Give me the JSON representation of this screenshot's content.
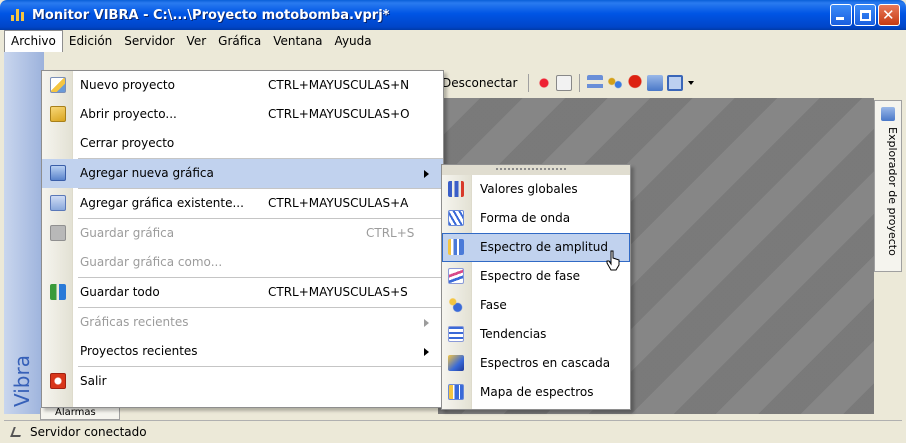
{
  "window": {
    "title": "Monitor VIBRA - C:\\...\\Proyecto motobomba.vprj*"
  },
  "menubar": {
    "items": [
      "Archivo",
      "Edición",
      "Servidor",
      "Ver",
      "Gráfica",
      "Ventana",
      "Ayuda"
    ]
  },
  "toolbar": {
    "disconnect_label": "Desconectar"
  },
  "explorer_tab": {
    "label": "Explorador de proyecto"
  },
  "sidebar": {
    "brand": "Vibra"
  },
  "alarm_tab": {
    "label": "Alarmas"
  },
  "statusbar": {
    "text": "Servidor conectado"
  },
  "file_menu": {
    "items": [
      {
        "label": "Nuevo proyecto",
        "shortcut": "CTRL+MAYUSCULAS+N",
        "icon": "new-project-icon",
        "enabled": true
      },
      {
        "label": "Abrir proyecto...",
        "shortcut": "CTRL+MAYUSCULAS+O",
        "icon": "open-folder-icon",
        "enabled": true
      },
      {
        "label": "Cerrar proyecto",
        "shortcut": "",
        "icon": "",
        "enabled": true
      },
      {
        "label": "Agregar nueva gráfica",
        "shortcut": "",
        "icon": "add-chart-icon",
        "enabled": true,
        "submenu": true,
        "highlighted": true
      },
      {
        "label": "Agregar gráfica existente...",
        "shortcut": "CTRL+MAYUSCULAS+A",
        "icon": "existing-chart-icon",
        "enabled": true
      },
      {
        "label": "Guardar gráfica",
        "shortcut": "CTRL+S",
        "icon": "save-icon",
        "enabled": false
      },
      {
        "label": "Guardar gráfica como...",
        "shortcut": "",
        "icon": "",
        "enabled": false
      },
      {
        "label": "Guardar todo",
        "shortcut": "CTRL+MAYUSCULAS+S",
        "icon": "save-all-icon",
        "enabled": true
      },
      {
        "label": "Gráficas recientes",
        "shortcut": "",
        "icon": "",
        "enabled": false,
        "submenu": true
      },
      {
        "label": "Proyectos recientes",
        "shortcut": "",
        "icon": "",
        "enabled": true,
        "submenu": true
      },
      {
        "label": "Salir",
        "shortcut": "",
        "icon": "exit-icon",
        "enabled": true
      }
    ]
  },
  "chart_submenu": {
    "items": [
      {
        "label": "Valores globales",
        "icon": "bar-chart-icon"
      },
      {
        "label": "Forma de onda",
        "icon": "waveform-icon"
      },
      {
        "label": "Espectro de amplitud",
        "icon": "amplitude-spectrum-icon",
        "highlighted": true
      },
      {
        "label": "Espectro de fase",
        "icon": "phase-spectrum-icon"
      },
      {
        "label": "Fase",
        "icon": "phase-icon"
      },
      {
        "label": "Tendencias",
        "icon": "trend-icon"
      },
      {
        "label": "Espectros en cascada",
        "icon": "cascade-icon"
      },
      {
        "label": "Mapa de espectros",
        "icon": "spectrum-map-icon"
      }
    ]
  },
  "colors": {
    "titlebar": "#0055e5",
    "highlight": "#c1d2ee",
    "highlight_border": "#316ac5",
    "disabled_text": "#9c9c9c"
  }
}
